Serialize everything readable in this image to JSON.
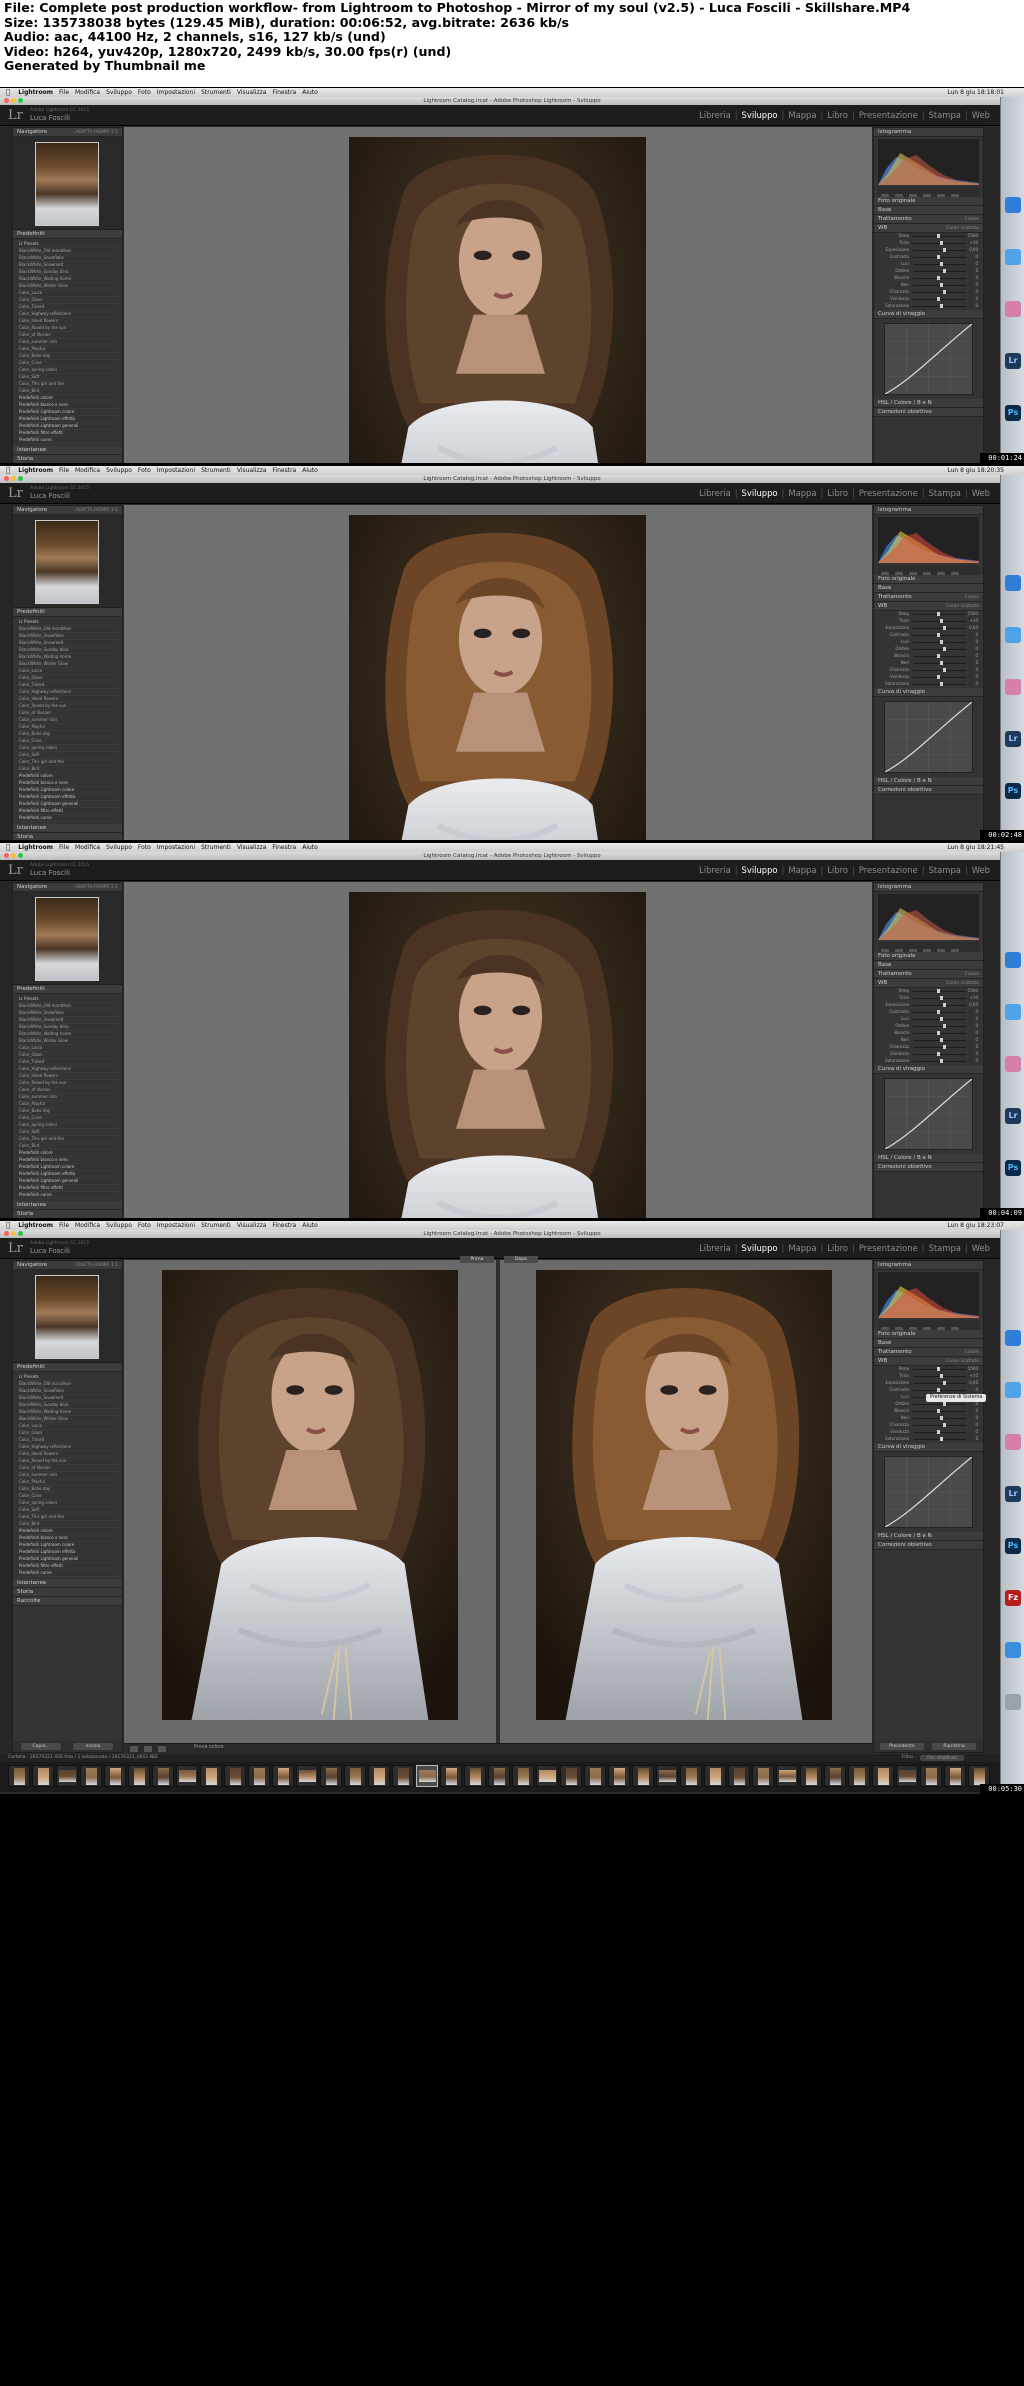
{
  "info": {
    "lines": [
      "File: Complete post production workflow- from Lightroom to Photoshop - Mirror of my soul (v2.5) - Luca Foscili - Skillshare.MP4",
      "Size: 135738038 bytes (129.45 MiB), duration: 00:06:52, avg.bitrate: 2636 kb/s",
      "Audio: aac, 44100 Hz, 2 channels, s16, 127 kb/s (und)",
      "Video: h264, yuv420p, 1280x720, 2499 kb/s, 30.00 fps(r) (und)",
      "Generated by Thumbnail me"
    ]
  },
  "menubar": {
    "app": "Lightroom",
    "items": [
      "File",
      "Modifica",
      "Sviluppo",
      "Foto",
      "Impostazioni",
      "Strumenti",
      "Visualizza",
      "Finestra",
      "Aiuto"
    ]
  },
  "window_title": "Lightroom Catalog.lrcat - Adobe Photoshop Lightroom - Sviluppo",
  "lr_header": {
    "catalog": "Adobe Lightroom CC 2015",
    "user": "Luca Foscili",
    "modules": [
      "Libreria",
      "Sviluppo",
      "Mappa",
      "Libro",
      "Presentazione",
      "Stampa",
      "Web"
    ],
    "active_module": "Sviluppo"
  },
  "left_panel": {
    "navigator": "Navigatore",
    "navigator_modes": "ADATTA  RIEMPI  1:1",
    "presets": "Predefiniti",
    "snapshots": "Istantanee",
    "history": "Storia",
    "collections": "Raccolte",
    "copy_btn": "Copia...",
    "paste_btn": "Incolla",
    "preset_items": [
      "Lr Presets",
      "BlackWhite_Old marathon",
      "BlackWhite_Snowflake",
      "BlackWhite_Snowmelt",
      "BlackWhite_Sunday bliss",
      "BlackWhite_Waiting home",
      "BlackWhite_Winter Glow",
      "Color_Lucia",
      "Color_Glass",
      "Color_Tinted",
      "Color_Highway reflections",
      "Color_Inked flowers",
      "Color_Roaed by the sun",
      "Color_of Illusion",
      "Color_summer rain",
      "Color_Playful",
      "Color_Bohe day",
      "Color_Cone",
      "Color_spring colors",
      "Color_Soft",
      "Color_This girl and the",
      "Color_Bird",
      "Predefiniti colore",
      "Predefiniti bianco e nero",
      "Predefiniti Lightroom colore",
      "Predefiniti Lightroom effetto",
      "Predefiniti Lightroom generali",
      "Predefiniti filtro effetti",
      "Predefiniti curve"
    ]
  },
  "right_panel": {
    "histogram": "Istogramma",
    "original_photo": "Foto originale",
    "basic": "Base",
    "treatment": "Trattamento",
    "color": "Colore",
    "bw": "Bianco e nero",
    "wb": "WB",
    "as_shot": "Come scattato",
    "tone": "Tono",
    "auto": "Automatico",
    "tone_curve": "Curva di viraggio",
    "hsl": "HSL / Colore / B e N",
    "lens_corrections": "Correzioni obiettivo",
    "prev_btn": "Precedente",
    "reset_btn": "Ripristina",
    "sliders": [
      {
        "label": "Temp",
        "value": "5500"
      },
      {
        "label": "Tinta",
        "value": "+10"
      },
      {
        "label": "Esposizione",
        "value": "0,00"
      },
      {
        "label": "Contrasto",
        "value": "0"
      },
      {
        "label": "Luci",
        "value": "0"
      },
      {
        "label": "Ombre",
        "value": "0"
      },
      {
        "label": "Bianchi",
        "value": "0"
      },
      {
        "label": "Neri",
        "value": "0"
      },
      {
        "label": "Chiarezza",
        "value": "0"
      },
      {
        "label": "Vividezza",
        "value": "0"
      },
      {
        "label": "Saturazione",
        "value": "0"
      }
    ]
  },
  "toolbar": {
    "soft_proof": "Prova colore"
  },
  "filmstrip": {
    "path": "Cartella : 20170321  456 foto / 1 selezionate / 20170321_0651.NEF",
    "filter": "Filtro :",
    "filter_value": "Filtri disattivati"
  },
  "frames": [
    {
      "timestamp": "00:01:24",
      "clock": "Lun 8 giu 18:18:01",
      "view": "single"
    },
    {
      "timestamp": "00:02:48",
      "clock": "Lun 8 giu 18:20:35",
      "view": "single"
    },
    {
      "timestamp": "00:04:09",
      "clock": "Lun 8 giu 18:21:45",
      "view": "single"
    },
    {
      "timestamp": "00:05:30",
      "clock": "Lun 8 giu 18:23:07",
      "view": "compare",
      "before_label": "Prima",
      "after_label": "Dopo",
      "tooltip": "Preferenze di Sistema"
    }
  ],
  "colors": {
    "accent": "#ffffff",
    "panel": "#343434",
    "stage": "#717171"
  }
}
